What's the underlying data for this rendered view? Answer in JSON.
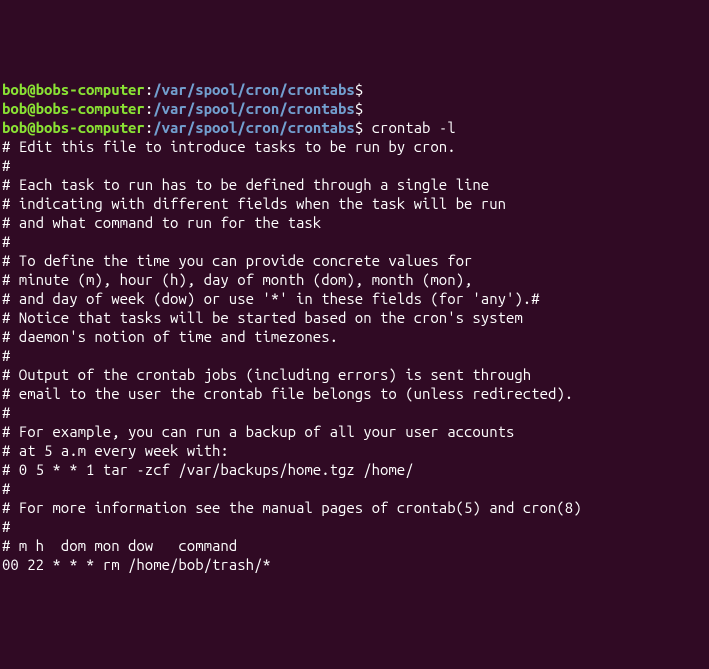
{
  "prompt": {
    "user_host": "bob@bobs-computer",
    "sep1": ":",
    "path": "/var/spool/cron/crontabs",
    "sigil": "$"
  },
  "commands": {
    "empty": "",
    "crontab": "crontab -l"
  },
  "output": {
    "l0": "# Edit this file to introduce tasks to be run by cron.",
    "l1": "#",
    "l2": "# Each task to run has to be defined through a single line",
    "l3": "# indicating with different fields when the task will be run",
    "l4": "# and what command to run for the task",
    "l5": "#",
    "l6": "# To define the time you can provide concrete values for",
    "l7": "# minute (m), hour (h), day of month (dom), month (mon),",
    "l8": "# and day of week (dow) or use '*' in these fields (for 'any').#",
    "l9": "# Notice that tasks will be started based on the cron's system",
    "l10": "# daemon's notion of time and timezones.",
    "l11": "#",
    "l12": "# Output of the crontab jobs (including errors) is sent through",
    "l13": "# email to the user the crontab file belongs to (unless redirected).",
    "l14": "#",
    "l15": "# For example, you can run a backup of all your user accounts",
    "l16": "# at 5 a.m every week with:",
    "l17": "# 0 5 * * 1 tar -zcf /var/backups/home.tgz /home/",
    "l18": "#",
    "l19": "# For more information see the manual pages of crontab(5) and cron(8)",
    "l20": "#",
    "l21": "# m h  dom mon dow   command",
    "l22": "",
    "l23": "00 22 * * * rm /home/bob/trash/*"
  }
}
